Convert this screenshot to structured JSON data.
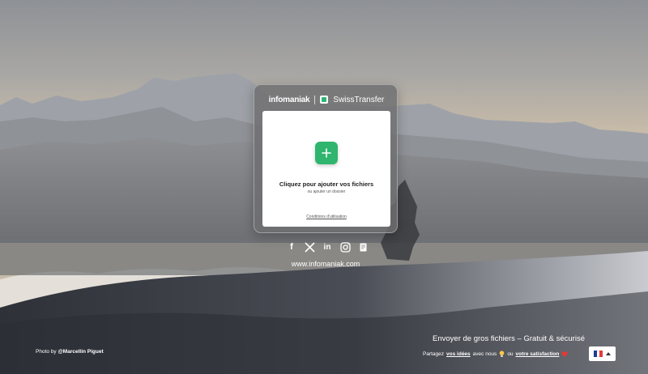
{
  "header": {
    "brand_primary": "infomaniak",
    "brand_product": "SwissTransfer"
  },
  "upload": {
    "title": "Cliquez pour ajouter vos fichiers",
    "subtitle": "ou ajouter un dossier",
    "terms_link": "Conditions d'utilisation",
    "add_icon": "plus-icon"
  },
  "social": {
    "items": [
      "facebook-icon",
      "x-icon",
      "linkedin-icon",
      "instagram-icon",
      "blog-icon"
    ],
    "facebook_label": "f",
    "linkedin_label": "in"
  },
  "footer": {
    "website": "www.infomaniak.com",
    "photo_credit_prefix": "Photo by ",
    "photo_credit_author": "@Marcellin Piguet",
    "tagline": "Envoyer de gros fichiers – Gratuit & sécurisé",
    "share_prefix": "Partagez ",
    "share_ideas": "vos idées",
    "share_middle": " avec nous ",
    "share_or": " ou ",
    "share_satisfaction": "votre satisfaction",
    "language_flag": "FR",
    "colors": {
      "accent": "#2fb56e",
      "heart": "#e53935"
    }
  }
}
